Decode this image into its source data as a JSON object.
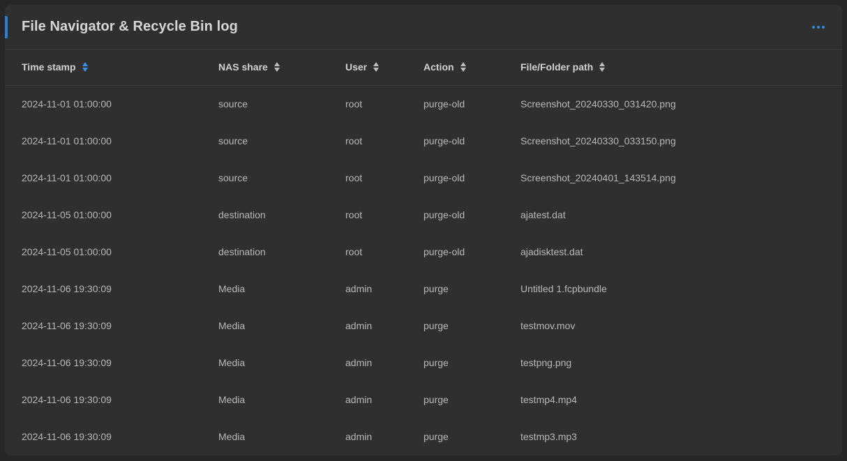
{
  "panel": {
    "title": "File Navigator & Recycle Bin log",
    "more_icon": "more-horizontal-icon",
    "accent_color": "#2a7fd4"
  },
  "table": {
    "columns": [
      {
        "key": "timestamp",
        "label": "Time stamp",
        "sort_icon": "sort-icon",
        "active_sort": true
      },
      {
        "key": "share",
        "label": "NAS share",
        "sort_icon": "sort-icon",
        "active_sort": false
      },
      {
        "key": "user",
        "label": "User",
        "sort_icon": "sort-icon",
        "active_sort": false
      },
      {
        "key": "action",
        "label": "Action",
        "sort_icon": "sort-icon",
        "active_sort": false
      },
      {
        "key": "path",
        "label": "File/Folder path",
        "sort_icon": "sort-icon",
        "active_sort": false
      }
    ],
    "rows": [
      {
        "timestamp": "2024-11-01 01:00:00",
        "share": "source",
        "user": "root",
        "action": "purge-old",
        "path": "Screenshot_20240330_031420.png"
      },
      {
        "timestamp": "2024-11-01 01:00:00",
        "share": "source",
        "user": "root",
        "action": "purge-old",
        "path": "Screenshot_20240330_033150.png"
      },
      {
        "timestamp": "2024-11-01 01:00:00",
        "share": "source",
        "user": "root",
        "action": "purge-old",
        "path": "Screenshot_20240401_143514.png"
      },
      {
        "timestamp": "2024-11-05 01:00:00",
        "share": "destination",
        "user": "root",
        "action": "purge-old",
        "path": "ajatest.dat"
      },
      {
        "timestamp": "2024-11-05 01:00:00",
        "share": "destination",
        "user": "root",
        "action": "purge-old",
        "path": "ajadisktest.dat"
      },
      {
        "timestamp": "2024-11-06 19:30:09",
        "share": "Media",
        "user": "admin",
        "action": "purge",
        "path": "Untitled 1.fcpbundle"
      },
      {
        "timestamp": "2024-11-06 19:30:09",
        "share": "Media",
        "user": "admin",
        "action": "purge",
        "path": "testmov.mov"
      },
      {
        "timestamp": "2024-11-06 19:30:09",
        "share": "Media",
        "user": "admin",
        "action": "purge",
        "path": "testpng.png"
      },
      {
        "timestamp": "2024-11-06 19:30:09",
        "share": "Media",
        "user": "admin",
        "action": "purge",
        "path": "testmp4.mp4"
      },
      {
        "timestamp": "2024-11-06 19:30:09",
        "share": "Media",
        "user": "admin",
        "action": "purge",
        "path": "testmp3.mp3"
      }
    ]
  }
}
